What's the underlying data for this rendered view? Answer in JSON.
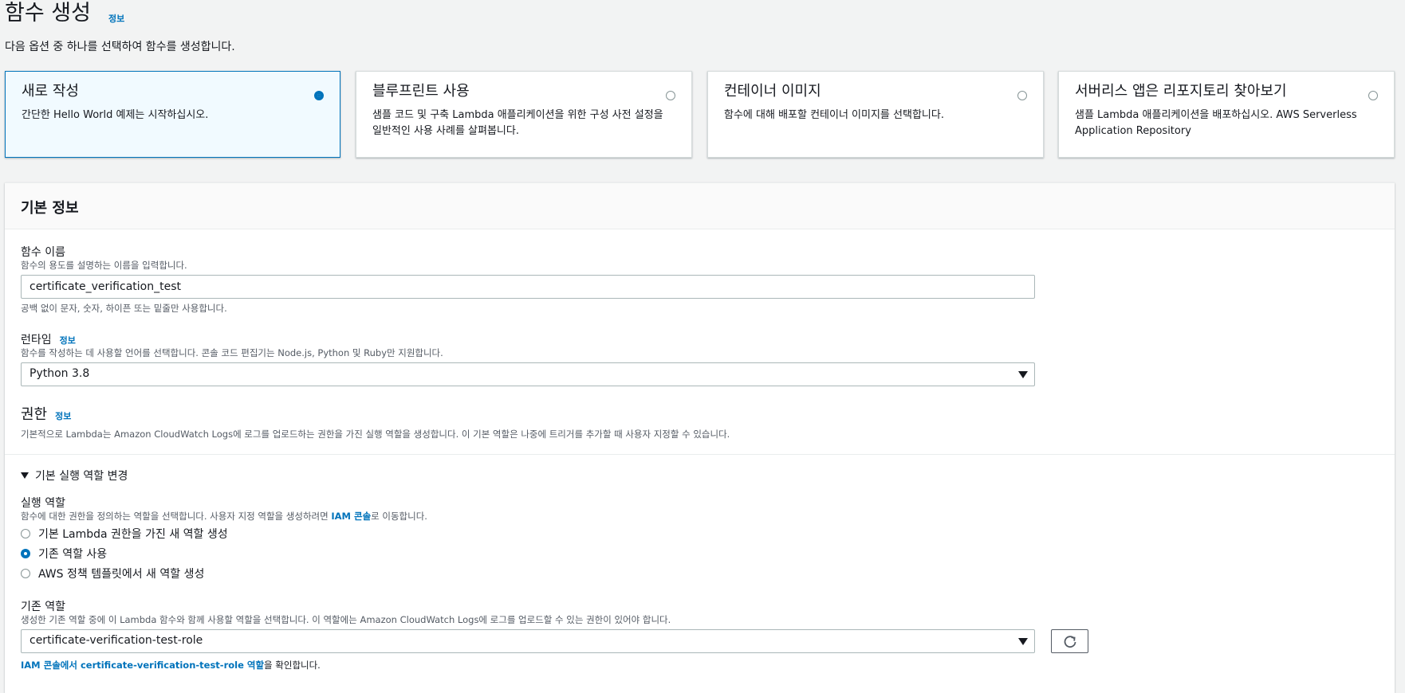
{
  "page": {
    "title": "함수 생성",
    "title_info": "정보",
    "description": "다음 옵션 중 하나를 선택하여 함수를 생성합니다."
  },
  "options": [
    {
      "title": "새로 작성",
      "description": "간단한 Hello World 예제는 시작하십시오.",
      "selected": true
    },
    {
      "title": "블루프린트 사용",
      "description": "샘플 코드 및 구축 Lambda 애플리케이션을 위한 구성 사전 설정을 일반적인 사용 사례를 살펴봅니다.",
      "selected": false
    },
    {
      "title": "컨테이너 이미지",
      "description": "함수에 대해 배포할 컨테이너 이미지를 선택합니다.",
      "selected": false
    },
    {
      "title": "서버리스 앱은 리포지토리 찾아보기",
      "description": "샘플 Lambda 애플리케이션을 배포하십시오. AWS Serverless Application Repository",
      "selected": false
    }
  ],
  "basic_info": {
    "header": "기본 정보",
    "function_name": {
      "label": "함수 이름",
      "description": "함수의 용도를 설명하는 이름을 입력합니다.",
      "value": "certificate_verification_test",
      "hint": "공백 없이 문자, 숫자, 하이픈 또는 밑줄만 사용합니다."
    },
    "runtime": {
      "label": "런타임",
      "info": "정보",
      "description": "함수를 작성하는 데 사용할 언어를 선택합니다. 콘솔 코드 편집기는 Node.js, Python 및 Ruby만 지원합니다.",
      "value": "Python 3.8"
    },
    "permissions": {
      "title": "권한",
      "info": "정보",
      "description": "기본적으로 Lambda는 Amazon CloudWatch Logs에 로그를 업로드하는 권한을 가진 실행 역할을 생성합니다. 이 기본 역할은 나중에 트리거를 추가할 때 사용자 지정할 수 있습니다."
    },
    "expand_label": "기본 실행 역할 변경",
    "execution_role": {
      "label": "실행 역할",
      "description_prefix": "함수에 대한 권한을 정의하는 역할을 선택합니다. 사용자 지정 역할을 생성하려면 ",
      "description_link": "IAM 콘솔",
      "description_suffix": "로 이동합니다.",
      "options": [
        {
          "label": "기본 Lambda 권한을 가진 새 역할 생성",
          "checked": false
        },
        {
          "label": "기존 역할 사용",
          "checked": true
        },
        {
          "label": "AWS 정책 템플릿에서 새 역할 생성",
          "checked": false
        }
      ]
    },
    "existing_role": {
      "label": "기존 역할",
      "description": "생성한 기존 역할 중에 이 Lambda 함수와 함께 사용할 역할을 선택합니다. 이 역할에는 Amazon CloudWatch Logs에 로그를 업로드할 수 있는 권한이 있어야 합니다.",
      "value": "certificate-verification-test-role",
      "footer_link": "IAM 콘솔에서 certificate-verification-test-role 역할",
      "footer_suffix": "을 확인합니다."
    }
  },
  "colors": {
    "accent": "#0073bb",
    "selected_bg": "#f1faff",
    "background": "#f2f3f3"
  }
}
